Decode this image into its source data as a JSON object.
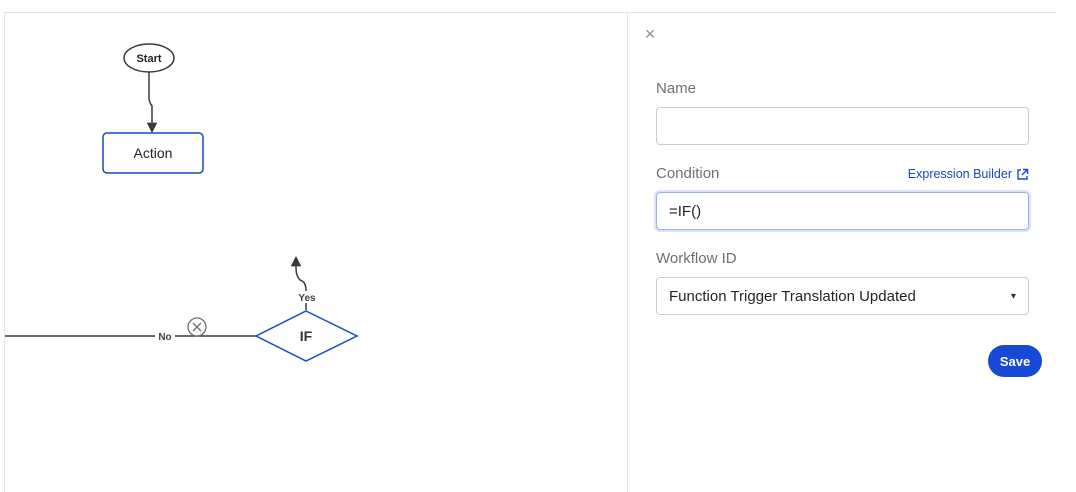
{
  "canvas": {
    "start_label": "Start",
    "action_label": "Action",
    "if_label": "IF",
    "yes_label": "Yes",
    "no_label": "No",
    "node_stroke": "#1a47c6",
    "edge_color": "#3a3a3a"
  },
  "panel": {
    "close_glyph": "×",
    "name_label": "Name",
    "name_value": "",
    "condition_label": "Condition",
    "expression_builder_label": "Expression Builder",
    "condition_value": "=IF()",
    "workflow_label": "Workflow ID",
    "workflow_value": "Function Trigger Translation Updated",
    "caret_glyph": "▾",
    "save_label": "Save"
  },
  "colors": {
    "accent": "#1749d6",
    "link": "#1a47c6"
  }
}
